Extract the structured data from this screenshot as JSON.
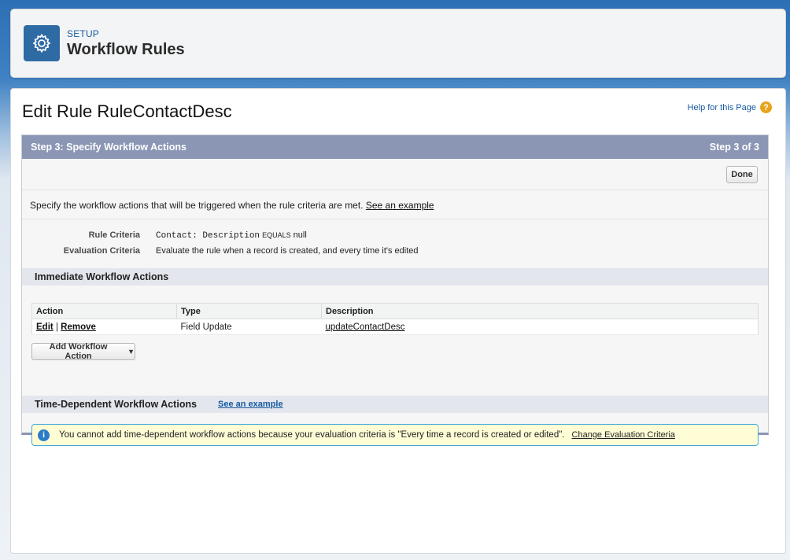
{
  "header": {
    "section": "SETUP",
    "title": "Workflow Rules",
    "icon": "gear-icon"
  },
  "page": {
    "title": "Edit Rule RuleContactDesc",
    "help_label": "Help for this Page",
    "help_icon": "question-icon"
  },
  "step": {
    "title": "Step 3: Specify Workflow Actions",
    "progress": "Step 3 of 3",
    "done_label": "Done",
    "description": "Specify the workflow actions that will be triggered when the rule criteria are met.",
    "example_link": "See an example"
  },
  "criteria": {
    "rule_label": "Rule Criteria",
    "rule_field": "Contact: Description",
    "rule_operator": "EQUALS",
    "rule_value": "null",
    "eval_label": "Evaluation Criteria",
    "eval_value": "Evaluate the rule when a record is created, and every time it's edited"
  },
  "immediate": {
    "heading": "Immediate Workflow Actions",
    "columns": [
      "Action",
      "Type",
      "Description"
    ],
    "rows": [
      {
        "edit": "Edit",
        "sep": "|",
        "remove": "Remove",
        "type": "Field Update",
        "description": "updateContactDesc"
      }
    ],
    "add_button": "Add Workflow Action",
    "add_caret": "▼"
  },
  "time_dependent": {
    "heading": "Time-Dependent Workflow Actions",
    "example_link": "See an example",
    "info_icon": "info-icon",
    "info_glyph": "i",
    "info_message": "You cannot add time-dependent workflow actions because your evaluation criteria is \"Every time a record is created or edited\".",
    "change_link": "Change Evaluation Criteria"
  },
  "colors": {
    "step_header": "#8b96b4",
    "link": "#155aa0",
    "info_bg": "#fffdd6",
    "info_border": "#46a7d8"
  }
}
